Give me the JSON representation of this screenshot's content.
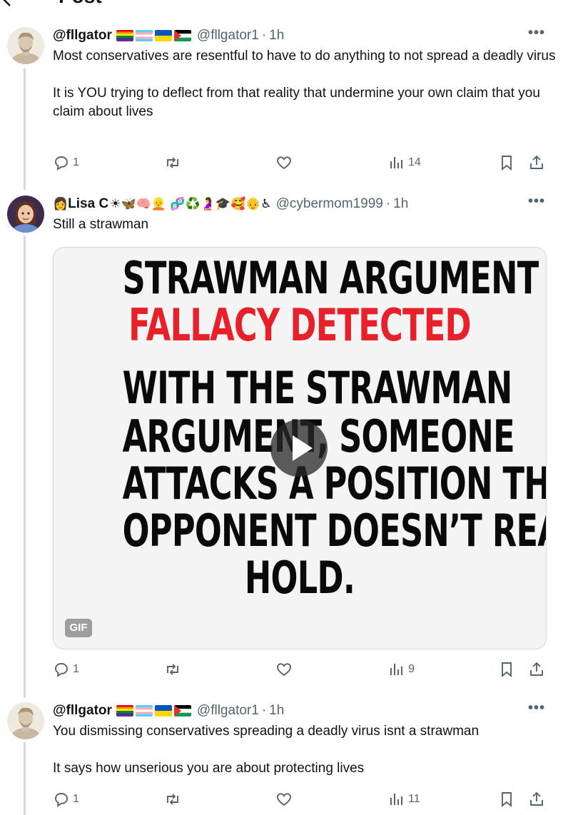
{
  "header": {
    "title": "Post"
  },
  "posts": [
    {
      "display_name": "@fllgator",
      "handle": "@fllgator1",
      "separator": "·",
      "time": "1h",
      "more": "•••",
      "paragraphs": [
        "Most conservatives are resentful to have to do anything to not spread a deadly virus",
        "It is YOU trying to deflect from that reality that undermine your own claim that you claim about lives"
      ],
      "replies": "1",
      "views": "14"
    },
    {
      "display_name": "Lisa C",
      "name_emojis": "☀🦋🧠👱 🧬♻️🤰🎓🥰👴♿",
      "handle": "@cybermom1999",
      "separator": "·",
      "time": "1h",
      "more": "•••",
      "paragraphs": [
        "Still a strawman"
      ],
      "replies": "1",
      "views": "9",
      "media": {
        "lines": [
          "STRAWMAN ARGUMENT",
          "FALLACY DETECTED",
          "WITH THE STRAWMAN",
          "ARGUMENT, SOMEONE",
          "ATTACKS A POSITION THE",
          "OPPONENT DOESN’T REALLY",
          "HOLD."
        ],
        "badge": "GIF"
      }
    },
    {
      "display_name": "@fllgator",
      "handle": "@fllgator1",
      "separator": "·",
      "time": "1h",
      "more": "•••",
      "paragraphs": [
        "You dismissing conservatives spreading a deadly virus isnt a strawman",
        "It says how unserious you are about protecting lives"
      ],
      "replies": "1",
      "views": "11"
    }
  ],
  "colors": {
    "text": "#0f1419",
    "muted": "#536471",
    "red": "#e8202a",
    "border": "#cfd9de"
  }
}
